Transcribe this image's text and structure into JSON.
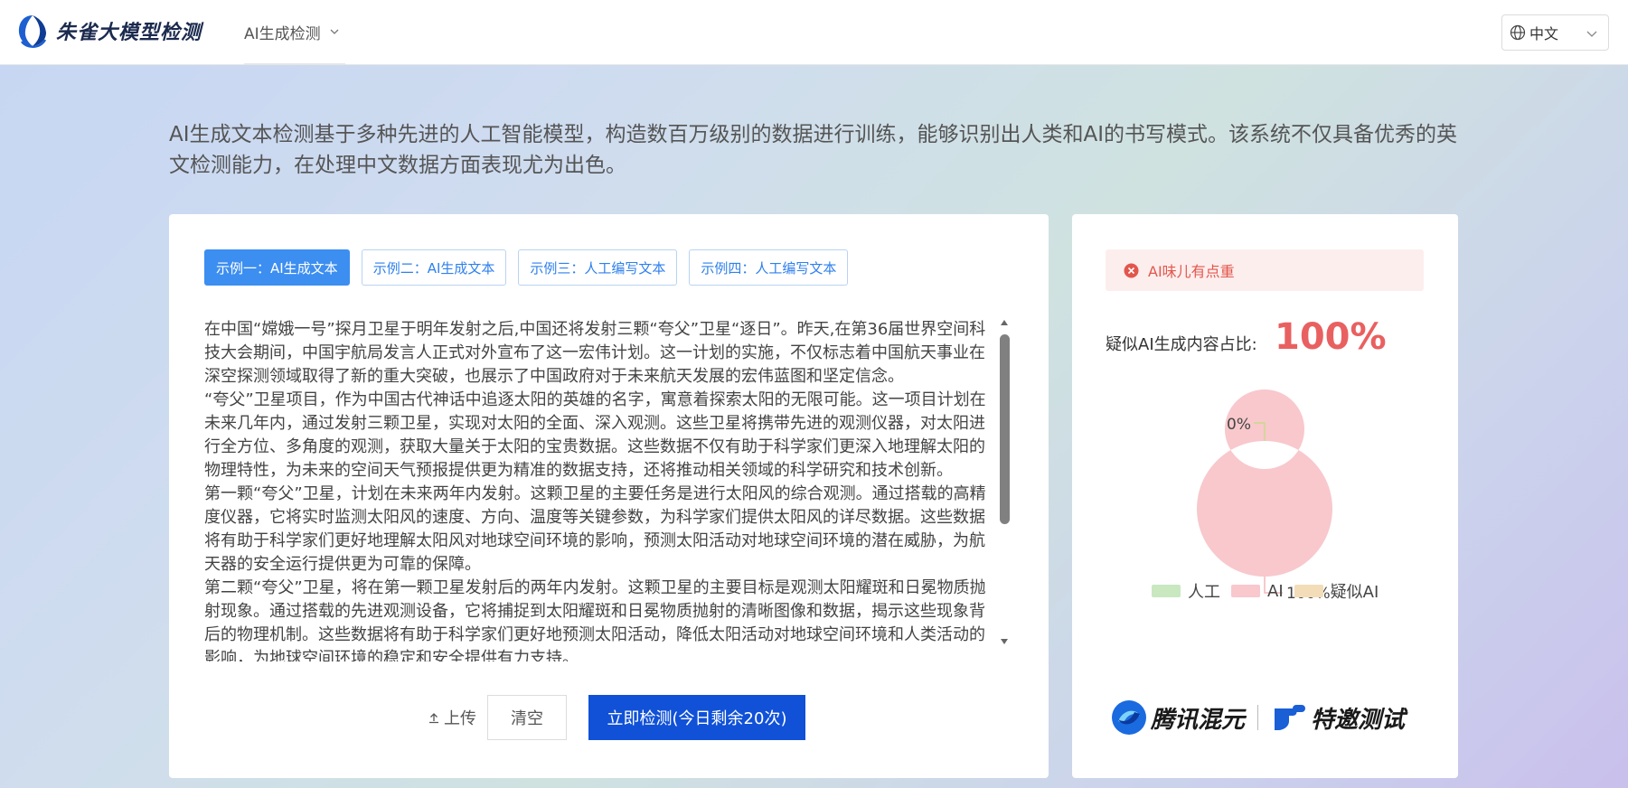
{
  "header": {
    "brand": "朱雀大模型检测",
    "nav_item": "AI生成检测",
    "language": "中文"
  },
  "intro": {
    "text": "AI生成文本检测基于多种先进的人工智能模型，构造数百万级别的数据进行训练，能够识别出人类和AI的书写模式。该系统不仅具备优秀的英文检测能力，在处理中文数据方面表现尤为出色。"
  },
  "tabs": [
    {
      "label": "示例一：AI生成文本",
      "active": true
    },
    {
      "label": "示例二：AI生成文本",
      "active": false
    },
    {
      "label": "示例三：人工编写文本",
      "active": false
    },
    {
      "label": "示例四：人工编写文本",
      "active": false
    }
  ],
  "editor": {
    "paragraphs": [
      "在中国“嫦娥一号”探月卫星于明年发射之后,中国还将发射三颗“夸父”卫星“逐日”。昨天,在第36届世界空间科技大会期间，中国宇航局发言人正式对外宣布了这一宏伟计划。这一计划的实施，不仅标志着中国航天事业在深空探测领域取得了新的重大突破，也展示了中国政府对于未来航天发展的宏伟蓝图和坚定信念。",
      "“夸父”卫星项目，作为中国古代神话中追逐太阳的英雄的名字，寓意着探索太阳的无限可能。这一项目计划在未来几年内，通过发射三颗卫星，实现对太阳的全面、深入观测。这些卫星将携带先进的观测仪器，对太阳进行全方位、多角度的观测，获取大量关于太阳的宝贵数据。这些数据不仅有助于科学家们更深入地理解太阳的物理特性，为未来的空间天气预报提供更为精准的数据支持，还将推动相关领域的科学研究和技术创新。",
      "第一颗“夸父”卫星，计划在未来两年内发射。这颗卫星的主要任务是进行太阳风的综合观测。通过搭载的高精度仪器，它将实时监测太阳风的速度、方向、温度等关键参数，为科学家们提供太阳风的详尽数据。这些数据将有助于科学家们更好地理解太阳风对地球空间环境的影响，预测太阳活动对地球空间环境的潜在威胁，为航天器的安全运行提供更为可靠的保障。",
      "第二颗“夸父”卫星，将在第一颗卫星发射后的两年内发射。这颗卫星的主要目标是观测太阳耀斑和日冕物质抛射现象。通过搭载的先进观测设备，它将捕捉到太阳耀斑和日冕物质抛射的清晰图像和数据，揭示这些现象背后的物理机制。这些数据将有助于科学家们更好地预测太阳活动，降低太阳活动对地球空间环境和人类活动的影响，为地球空间环境的稳定和安全提供有力支持。"
    ]
  },
  "actions": {
    "upload": "上传",
    "clear": "清空",
    "detect": "立即检测(今日剩余20次)"
  },
  "result": {
    "alert": "AI味儿有点重",
    "ratio_label": "疑似AI生成内容占比:",
    "ratio_value": "100%"
  },
  "chart_data": {
    "type": "pie",
    "categories": [
      "人工",
      "AI",
      "疑似AI"
    ],
    "values": [
      0,
      100,
      0
    ],
    "labels": [
      "0%",
      "100%"
    ],
    "colors": [
      "#c9e8c0",
      "#f8c8cc",
      "#f3ddb8"
    ],
    "legend_position": "bottom"
  },
  "footer": {
    "brand1": "腾讯混元",
    "brand2": "特邀测试"
  }
}
